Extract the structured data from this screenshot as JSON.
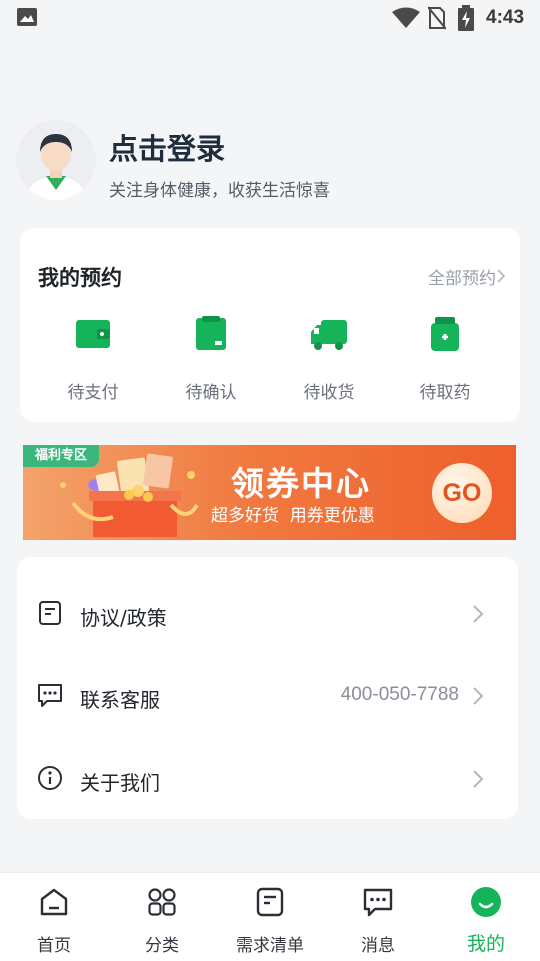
{
  "status_bar": {
    "time": "4:43"
  },
  "profile": {
    "title": "点击登录",
    "subtitle": "关注身体健康，收获生活惊喜"
  },
  "appointments": {
    "title": "我的预约",
    "all_link": "全部预约",
    "items": [
      {
        "label": "待支付",
        "icon": "wallet-icon"
      },
      {
        "label": "待确认",
        "icon": "clipboard-icon"
      },
      {
        "label": "待收货",
        "icon": "truck-icon"
      },
      {
        "label": "待取药",
        "icon": "medicine-icon"
      }
    ]
  },
  "banner": {
    "tag": "福利专区",
    "title": "领券中心",
    "subtitle": "超多好货  用券更优惠",
    "go": "GO"
  },
  "menu": {
    "items": [
      {
        "label": "协议/政策",
        "value": "",
        "icon": "document-icon"
      },
      {
        "label": "联系客服",
        "value": "400-050-7788",
        "icon": "chat-icon"
      },
      {
        "label": "关于我们",
        "value": "",
        "icon": "info-icon"
      }
    ]
  },
  "bottom_nav": {
    "items": [
      {
        "label": "首页",
        "icon": "home-icon"
      },
      {
        "label": "分类",
        "icon": "grid-icon"
      },
      {
        "label": "需求清单",
        "icon": "list-icon"
      },
      {
        "label": "消息",
        "icon": "message-icon"
      },
      {
        "label": "我的",
        "icon": "profile-icon",
        "active": true
      }
    ]
  },
  "colors": {
    "accent": "#16b45a",
    "banner_start": "#f4a26b",
    "banner_end": "#ee5f2c"
  }
}
